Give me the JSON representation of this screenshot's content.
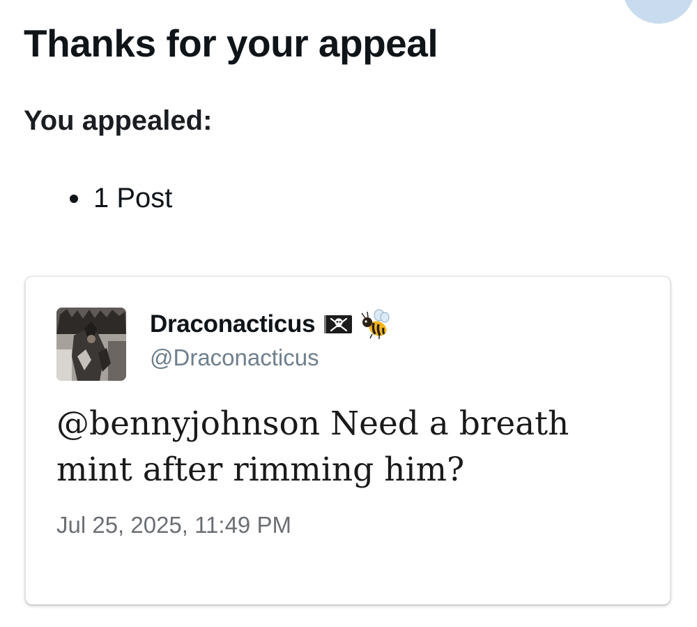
{
  "page": {
    "title": "Thanks for your appeal",
    "subtitle": "You appealed:",
    "appealed_items": [
      {
        "label": "1 Post"
      }
    ]
  },
  "post": {
    "author": {
      "display_name": "Draconacticus",
      "handle": "@Draconacticus",
      "badges": [
        "pirate-flag-icon",
        "bee-icon"
      ]
    },
    "text": "@bennyjohnson Need a breath mint after rimming him?",
    "timestamp": "Jul 25, 2025, 11:49 PM"
  },
  "colors": {
    "text_primary": "#0f1419",
    "text_secondary": "#6f7f8c",
    "card_border": "#e3e6e9",
    "corner_avatar": "#c9dcef"
  }
}
